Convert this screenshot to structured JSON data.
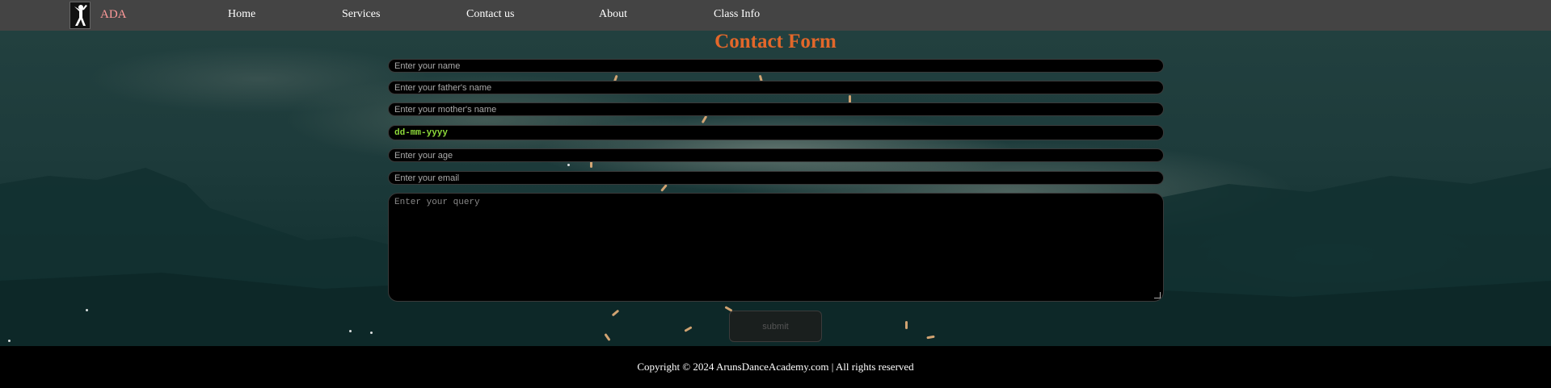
{
  "navbar": {
    "brand": "ADA",
    "logo_icon": "dancer-silhouette-icon",
    "links": [
      "Home",
      "Services",
      "Contact us",
      "About",
      "Class Info"
    ]
  },
  "form": {
    "title": "Contact Form",
    "name_placeholder": "Enter your name",
    "father_placeholder": "Enter your father's name",
    "mother_placeholder": "Enter your mother's name",
    "date_placeholder": "dd-mm-yyyy",
    "age_placeholder": "Enter your age",
    "email_placeholder": "Enter your email",
    "query_placeholder": "Enter your query",
    "submit_label": "submit"
  },
  "footer": {
    "text": "Copyright © 2024 ArunsDanceAcademy.com | All rights reserved"
  },
  "colors": {
    "navbar_bg": "#444444",
    "brand": "#ff9a9a",
    "title": "#e2672a",
    "date_text": "#8fdc3a",
    "footer_bg": "#000000"
  }
}
